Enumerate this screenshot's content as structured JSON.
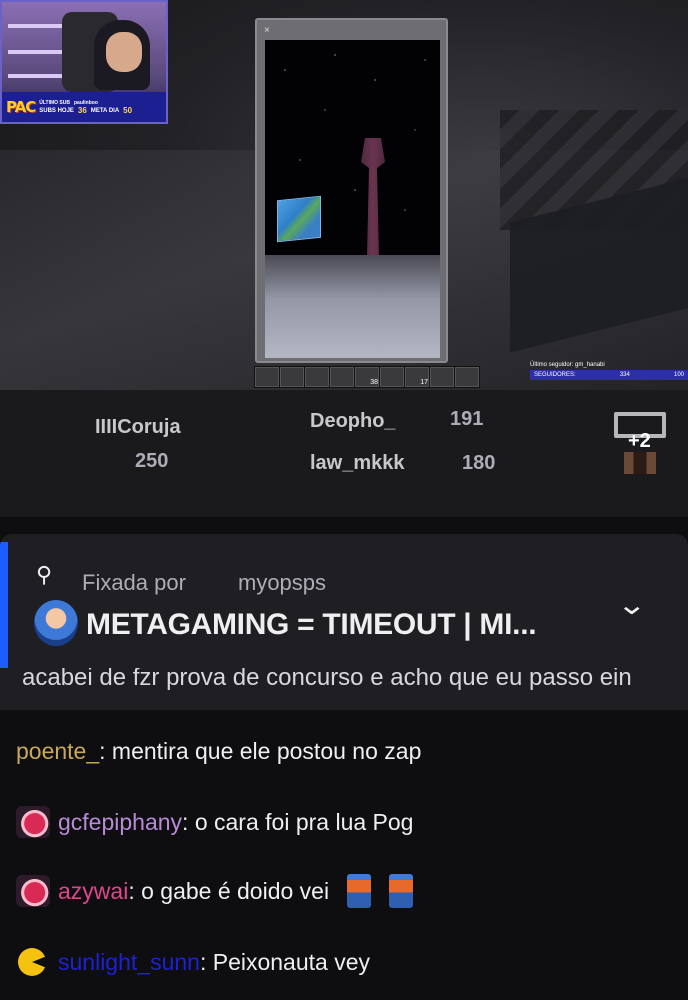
{
  "stream": {
    "overlay": {
      "brand": "PAC",
      "last_sub_label": "ÚLTIMO SUB",
      "last_sub_user": "paulinboo",
      "subs_today_label": "SUBS HOJE",
      "subs_today": "36",
      "goal_label": "META DIA",
      "goal": "50"
    },
    "hotbar_counts": [
      "",
      "",
      "",
      "",
      "38",
      "",
      "17",
      "",
      ""
    ],
    "follower_label": "Último seguidor: gm_hanabi",
    "followers_label": "SEGUIDORES:",
    "followers_count": "334",
    "followers_goal": "100"
  },
  "leaderboard": {
    "first": {
      "name": "IIIICoruja",
      "value": "250"
    },
    "second": {
      "name": "Deopho_",
      "value": "191"
    },
    "third": {
      "name": "law_mkkk",
      "value": "180"
    },
    "more": "+2"
  },
  "pinned": {
    "pinned_by_label": "Fixada por",
    "pinned_by_user": "myopsps",
    "message": "METAGAMING = TIMEOUT | MI...",
    "partial_line": "acabei de fzr prova de concurso e acho que eu passo ein"
  },
  "chat": [
    {
      "user": "poente_",
      "color": "#c8a85a",
      "text": ": mentira que ele postou no zap",
      "badge": ""
    },
    {
      "user": "gcfepiphany",
      "color": "#b98ad6",
      "text": ": o cara foi pra lua Pog",
      "badge": "mouth-icon"
    },
    {
      "user": "azywai",
      "color": "#e0468a",
      "text": ": o gabe é doido vei",
      "badge": "mouth-icon"
    },
    {
      "user": "sunlight_sunn",
      "color": "#1c21d6",
      "text": ": Peixonauta vey",
      "badge": "pacman-icon"
    }
  ]
}
